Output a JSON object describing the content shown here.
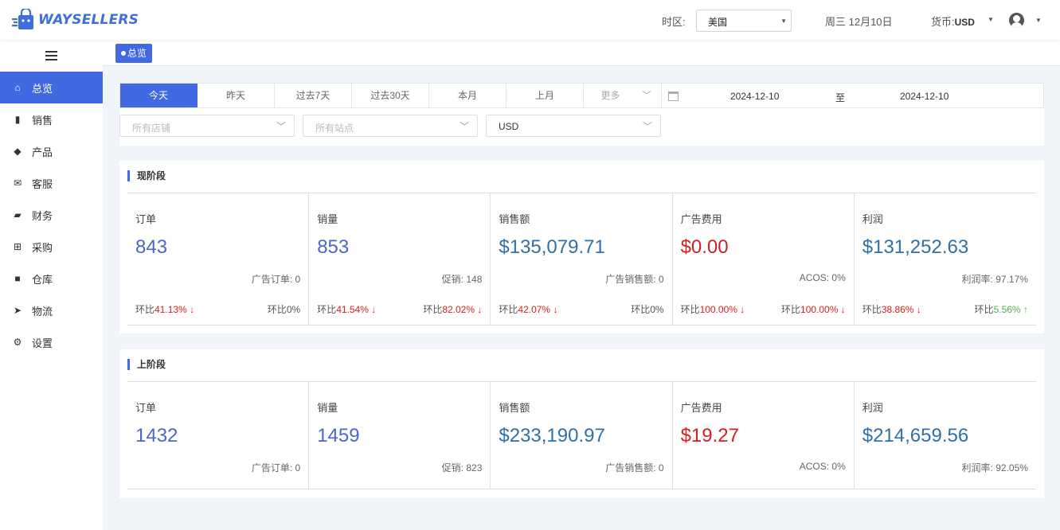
{
  "header": {
    "brand": "WAYSELLERS",
    "timezone_label": "时区:",
    "timezone_value": "美国",
    "date": "周三 12月10日",
    "currency_label": "货币:",
    "currency_value": "USD"
  },
  "sidebar": {
    "items": [
      {
        "label": "总览",
        "icon": "home-icon",
        "glyph": "⌂"
      },
      {
        "label": "销售",
        "icon": "bar-chart-icon",
        "glyph": "▮"
      },
      {
        "label": "产品",
        "icon": "bag-icon",
        "glyph": "◆"
      },
      {
        "label": "客服",
        "icon": "envelope-icon",
        "glyph": "✉"
      },
      {
        "label": "财务",
        "icon": "wallet-icon",
        "glyph": "▰"
      },
      {
        "label": "采购",
        "icon": "cart-icon",
        "glyph": "⊞"
      },
      {
        "label": "仓库",
        "icon": "warehouse-icon",
        "glyph": "■"
      },
      {
        "label": "物流",
        "icon": "plane-icon",
        "glyph": "➤"
      },
      {
        "label": "设置",
        "icon": "gear-icon",
        "glyph": "⚙"
      }
    ]
  },
  "tabs": {
    "overview": "总览"
  },
  "filters": {
    "periods": [
      "今天",
      "昨天",
      "过去7天",
      "过去30天",
      "本月",
      "上月"
    ],
    "more": "更多",
    "date_start": "2024-12-10",
    "date_to": "至",
    "date_end": "2024-12-10",
    "store_placeholder": "所有店铺",
    "site_placeholder": "所有站点",
    "currency": "USD"
  },
  "current": {
    "title": "现阶段",
    "orders": {
      "label": "订单",
      "value": "843",
      "sub_label": "广告订单:",
      "sub_value": "0",
      "cmp_l_label": "环比",
      "cmp_l_value": "41.13%",
      "cmp_r_label": "环比",
      "cmp_r_value": "0%"
    },
    "qty": {
      "label": "销量",
      "value": "853",
      "sub_label": "促销:",
      "sub_value": "148",
      "cmp_l_label": "环比",
      "cmp_l_value": "41.54%",
      "cmp_r_label": "环比",
      "cmp_r_value": "82.02%"
    },
    "sales": {
      "label": "销售额",
      "value": "$135,079.71",
      "sub_label": "广告销售额:",
      "sub_value": "0",
      "cmp_l_label": "环比",
      "cmp_l_value": "42.07%",
      "cmp_r_label": "环比",
      "cmp_r_value": "0%"
    },
    "ad": {
      "label": "广告费用",
      "value": "$0.00",
      "sub_label": "ACOS:",
      "sub_value": "0%",
      "cmp_l_label": "环比",
      "cmp_l_value": "100.00%",
      "cmp_r_label": "环比",
      "cmp_r_value": "100.00%"
    },
    "profit": {
      "label": "利润",
      "value": "$131,252.63",
      "sub_label": "利润率:",
      "sub_value": "97.17%",
      "cmp_l_label": "环比",
      "cmp_l_value": "38.86%",
      "cmp_r_label": "环比",
      "cmp_r_value": "5.56%"
    }
  },
  "previous": {
    "title": "上阶段",
    "orders": {
      "label": "订单",
      "value": "1432",
      "sub_label": "广告订单:",
      "sub_value": "0"
    },
    "qty": {
      "label": "销量",
      "value": "1459",
      "sub_label": "促销:",
      "sub_value": "823"
    },
    "sales": {
      "label": "销售额",
      "value": "$233,190.97",
      "sub_label": "广告销售额:",
      "sub_value": "0"
    },
    "ad": {
      "label": "广告费用",
      "value": "$19.27",
      "sub_label": "ACOS:",
      "sub_value": "0%"
    },
    "profit": {
      "label": "利润",
      "value": "$214,659.56",
      "sub_label": "利润率:",
      "sub_value": "92.05%"
    }
  },
  "arrows": {
    "down": "↓",
    "up": "↑"
  },
  "colors": {
    "accent": "#4169e1",
    "down": "#d71e1e",
    "up": "#4caf50"
  }
}
